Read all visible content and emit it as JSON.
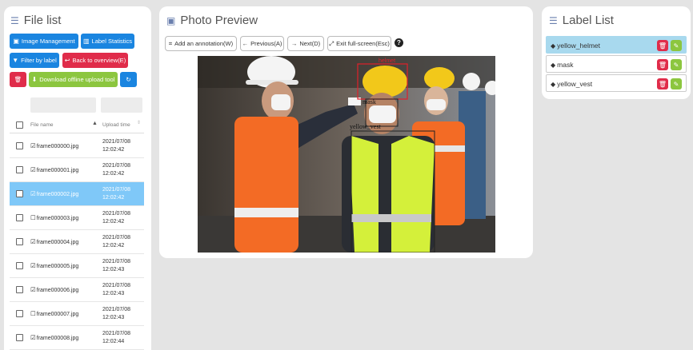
{
  "file_panel": {
    "title": "File list",
    "buttons": {
      "image_management": "Image Management",
      "label_statistics": "Label Statistics",
      "filter_by_label": "Filter by label",
      "back_to_overview": "Back to overview(E)",
      "download_tool": "Download offline upload tool"
    },
    "columns": {
      "file_name": "File name",
      "upload_time": "Upload time"
    },
    "rows": [
      {
        "name": "frame000000.jpg",
        "date": "2021/07/08",
        "time": "12:02:42",
        "checked": true,
        "selected": false
      },
      {
        "name": "frame000001.jpg",
        "date": "2021/07/08",
        "time": "12:02:42",
        "checked": true,
        "selected": false
      },
      {
        "name": "frame000002.jpg",
        "date": "2021/07/08",
        "time": "12:02:42",
        "checked": true,
        "selected": true
      },
      {
        "name": "frame000003.jpg",
        "date": "2021/07/08",
        "time": "12:02:42",
        "checked": false,
        "selected": false
      },
      {
        "name": "frame000004.jpg",
        "date": "2021/07/08",
        "time": "12:02:42",
        "checked": true,
        "selected": false
      },
      {
        "name": "frame000005.jpg",
        "date": "2021/07/08",
        "time": "12:02:43",
        "checked": true,
        "selected": false
      },
      {
        "name": "frame000006.jpg",
        "date": "2021/07/08",
        "time": "12:02:43",
        "checked": true,
        "selected": false
      },
      {
        "name": "frame000007.jpg",
        "date": "2021/07/08",
        "time": "12:02:43",
        "checked": false,
        "selected": false
      },
      {
        "name": "frame000008.jpg",
        "date": "2021/07/08",
        "time": "12:02:44",
        "checked": true,
        "selected": false
      }
    ]
  },
  "preview_panel": {
    "title": "Photo Preview",
    "buttons": {
      "add_annotation": "Add an annotation(W)",
      "previous": "Previous(A)",
      "next": "Next(D)",
      "exit_fullscreen": "Exit full-screen(Esc)"
    },
    "annotations": {
      "helmet": "helmet",
      "mask": "mask",
      "vest": "yellow_vest"
    }
  },
  "label_panel": {
    "title": "Label List",
    "labels": [
      {
        "name": "yellow_helmet",
        "selected": true
      },
      {
        "name": "mask",
        "selected": false
      },
      {
        "name": "yellow_vest",
        "selected": false
      }
    ]
  },
  "colors": {
    "primary_blue": "#1a85e0",
    "danger_red": "#e02c4a",
    "success_green": "#8cc63f",
    "selected_row": "#7fc8f8",
    "selected_label": "#a8d9ee"
  },
  "icons": [
    "list-icon",
    "image-icon",
    "bar-chart-icon",
    "filter-icon",
    "back-arrow-icon",
    "trash-icon",
    "download-icon",
    "refresh-icon",
    "crop-icon",
    "arrow-left-icon",
    "arrow-right-icon",
    "expand-icon",
    "help-icon",
    "tag-icon",
    "pencil-icon",
    "sort-icon"
  ]
}
